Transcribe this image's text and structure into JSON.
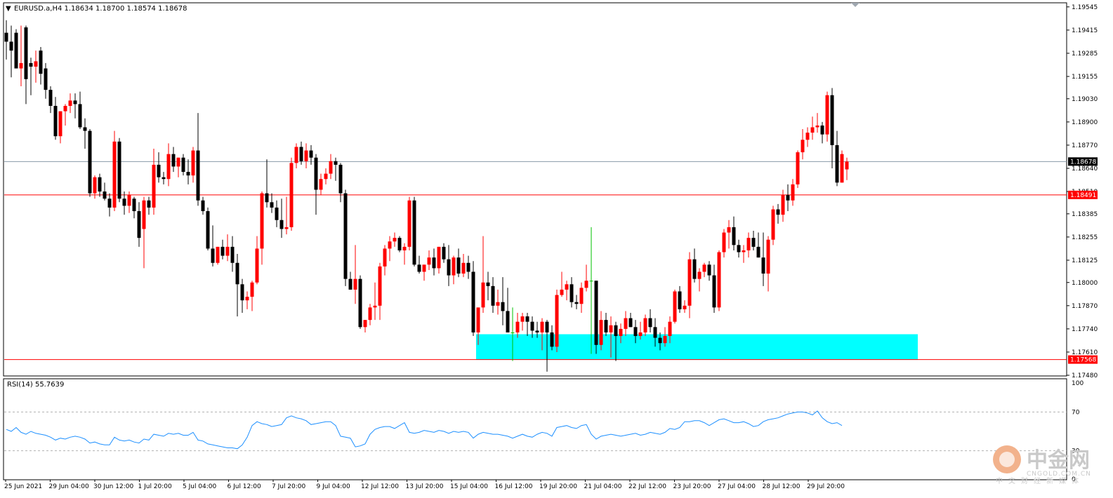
{
  "chart_header": {
    "symbol_line": "EURUSD.a,H4  1.18634 1.18700 1.18574 1.18678",
    "collapse_arrow": "triangle-down-icon"
  },
  "rsi_panel": {
    "label": "RSI(14) 55.7639",
    "levels": [
      "100",
      "70",
      "30",
      "0"
    ]
  },
  "price_axis": {
    "ticks": [
      "1.19545",
      "1.19415",
      "1.19285",
      "1.19155",
      "1.19030",
      "1.18900",
      "1.18770",
      "1.18640",
      "1.18510",
      "1.18385",
      "1.18255",
      "1.18125",
      "1.18000",
      "1.17870",
      "1.17740",
      "1.17610",
      "1.17480"
    ],
    "current_price_tag": "1.18678",
    "resistance_tag": "1.18491",
    "support_tag": "1.17568"
  },
  "time_axis": {
    "labels": [
      "25 Jun 2021",
      "29 Jun 04:00",
      "30 Jun 12:00",
      "1 Jul 20:00",
      "5 Jul 04:00",
      "6 Jul 12:00",
      "7 Jul 20:00",
      "9 Jul 04:00",
      "12 Jul 12:00",
      "13 Jul 20:00",
      "15 Jul 04:00",
      "16 Jul 12:00",
      "19 Jul 20:00",
      "21 Jul 04:00",
      "22 Jul 12:00",
      "23 Jul 20:00",
      "27 Jul 04:00",
      "28 Jul 12:00",
      "29 Jul 20:00"
    ]
  },
  "watermark": {
    "brand_cn": "中金网",
    "brand_url": "CNGOLD.COM.CN",
    "tagline": "中文财经新媒体"
  },
  "colors": {
    "bull": "#ff0000",
    "bear": "#000000",
    "doji": "#00c000",
    "support_zone": "#00ffff",
    "hline": "#ff0000",
    "current_line": "#8a9aa8",
    "rsi_line": "#1e90ff",
    "tag_bg_current": "#000000",
    "tag_bg_level": "#ff0000"
  },
  "chart_data": {
    "type": "candlestick",
    "symbol": "EURUSD.a",
    "timeframe": "H4",
    "ylim": [
      1.1748,
      1.1956
    ],
    "horizontal_levels": [
      1.18491,
      1.17568
    ],
    "current_price": 1.18678,
    "support_zone": {
      "price_low": 1.17568,
      "price_high": 1.1771,
      "from_bar": 96,
      "to_bar": 185
    },
    "candles": [
      [
        1.194,
        1.1947,
        1.1925,
        1.1935
      ],
      [
        1.1935,
        1.1944,
        1.1915,
        1.193
      ],
      [
        1.194,
        1.1942,
        1.192,
        1.192
      ],
      [
        1.192,
        1.1944,
        1.191,
        1.1923
      ],
      [
        1.1943,
        1.1944,
        1.19,
        1.1914
      ],
      [
        1.1923,
        1.1926,
        1.1905,
        1.1921
      ],
      [
        1.1921,
        1.193,
        1.1912,
        1.1924
      ],
      [
        1.193,
        1.1932,
        1.1911,
        1.1917
      ],
      [
        1.192,
        1.1923,
        1.1903,
        1.1908
      ],
      [
        1.1908,
        1.191,
        1.1895,
        1.1899
      ],
      [
        1.1899,
        1.1904,
        1.188,
        1.1882
      ],
      [
        1.1882,
        1.1896,
        1.1878,
        1.1896
      ],
      [
        1.1896,
        1.19,
        1.1888,
        1.1899
      ],
      [
        1.1899,
        1.1906,
        1.1895,
        1.1902
      ],
      [
        1.1902,
        1.1906,
        1.1892,
        1.19
      ],
      [
        1.19,
        1.1907,
        1.1886,
        1.1887
      ],
      [
        1.1887,
        1.1892,
        1.1875,
        1.1885
      ],
      [
        1.1885,
        1.1886,
        1.1848,
        1.185
      ],
      [
        1.185,
        1.186,
        1.1847,
        1.1859
      ],
      [
        1.1859,
        1.1861,
        1.1848,
        1.1851
      ],
      [
        1.1851,
        1.1856,
        1.1846,
        1.1847
      ],
      [
        1.1847,
        1.185,
        1.1837,
        1.1842
      ],
      [
        1.1842,
        1.1885,
        1.184,
        1.1879
      ],
      [
        1.1879,
        1.1881,
        1.1845,
        1.1847
      ],
      [
        1.1847,
        1.1851,
        1.1838,
        1.1843
      ],
      [
        1.1843,
        1.1851,
        1.1839,
        1.1849
      ],
      [
        1.1847,
        1.1848,
        1.1836,
        1.184
      ],
      [
        1.184,
        1.1845,
        1.182,
        1.1825
      ],
      [
        1.183,
        1.1848,
        1.1808,
        1.1846
      ],
      [
        1.1846,
        1.1848,
        1.1838,
        1.1842
      ],
      [
        1.1842,
        1.1875,
        1.1838,
        1.1866
      ],
      [
        1.1866,
        1.1873,
        1.1856,
        1.1859
      ],
      [
        1.1859,
        1.1862,
        1.1855,
        1.1858
      ],
      [
        1.1858,
        1.1878,
        1.1854,
        1.1872
      ],
      [
        1.1872,
        1.1876,
        1.1862,
        1.1865
      ],
      [
        1.1865,
        1.187,
        1.1859,
        1.187
      ],
      [
        1.187,
        1.1872,
        1.186,
        1.1862
      ],
      [
        1.1862,
        1.1869,
        1.1855,
        1.186
      ],
      [
        1.186,
        1.1876,
        1.1856,
        1.1874
      ],
      [
        1.1874,
        1.1895,
        1.1843,
        1.1846
      ],
      [
        1.1846,
        1.1848,
        1.1838,
        1.184
      ],
      [
        1.184,
        1.1842,
        1.1818,
        1.1819
      ],
      [
        1.1819,
        1.1832,
        1.1809,
        1.1811
      ],
      [
        1.1811,
        1.182,
        1.181,
        1.182
      ],
      [
        1.182,
        1.1824,
        1.1813,
        1.1815
      ],
      [
        1.1815,
        1.1827,
        1.1812,
        1.182
      ],
      [
        1.182,
        1.1826,
        1.1806,
        1.1811
      ],
      [
        1.1811,
        1.1816,
        1.1781,
        1.1799
      ],
      [
        1.1799,
        1.1802,
        1.1783,
        1.179
      ],
      [
        1.179,
        1.1795,
        1.1785,
        1.1792
      ],
      [
        1.1792,
        1.1801,
        1.1784,
        1.18
      ],
      [
        1.18,
        1.1826,
        1.1799,
        1.1819
      ],
      [
        1.1819,
        1.1851,
        1.181,
        1.185
      ],
      [
        1.185,
        1.1869,
        1.1842,
        1.1845
      ],
      [
        1.1845,
        1.185,
        1.1839,
        1.1842
      ],
      [
        1.1842,
        1.1846,
        1.1831,
        1.1835
      ],
      [
        1.1835,
        1.1847,
        1.1825,
        1.183
      ],
      [
        1.183,
        1.1848,
        1.1827,
        1.1831
      ],
      [
        1.1831,
        1.187,
        1.1829,
        1.1867
      ],
      [
        1.1867,
        1.1878,
        1.1864,
        1.1876
      ],
      [
        1.1876,
        1.1879,
        1.1866,
        1.1868
      ],
      [
        1.1868,
        1.1878,
        1.1864,
        1.1874
      ],
      [
        1.1874,
        1.1877,
        1.1866,
        1.187
      ],
      [
        1.187,
        1.1872,
        1.1838,
        1.1852
      ],
      [
        1.1852,
        1.1861,
        1.1849,
        1.1858
      ],
      [
        1.1858,
        1.1864,
        1.1855,
        1.1861
      ],
      [
        1.1861,
        1.1872,
        1.1858,
        1.1868
      ],
      [
        1.1868,
        1.187,
        1.1857,
        1.1866
      ],
      [
        1.1866,
        1.1867,
        1.1845,
        1.185
      ],
      [
        1.185,
        1.1852,
        1.1798,
        1.1802
      ],
      [
        1.1802,
        1.1806,
        1.1796,
        1.1796
      ],
      [
        1.1796,
        1.1821,
        1.1788,
        1.1802
      ],
      [
        1.1802,
        1.1804,
        1.1774,
        1.1775
      ],
      [
        1.1775,
        1.1779,
        1.1772,
        1.1779
      ],
      [
        1.1779,
        1.1788,
        1.1776,
        1.1786
      ],
      [
        1.1786,
        1.18,
        1.1779,
        1.1787
      ],
      [
        1.1787,
        1.1811,
        1.1779,
        1.1809
      ],
      [
        1.1809,
        1.1821,
        1.1804,
        1.1819
      ],
      [
        1.1819,
        1.1826,
        1.1812,
        1.1823
      ],
      [
        1.1823,
        1.1828,
        1.182,
        1.1825
      ],
      [
        1.1825,
        1.1826,
        1.1817,
        1.1818
      ],
      [
        1.1818,
        1.1822,
        1.181,
        1.182
      ],
      [
        1.182,
        1.1848,
        1.1818,
        1.1846
      ],
      [
        1.1846,
        1.1848,
        1.1809,
        1.181
      ],
      [
        1.181,
        1.1815,
        1.1805,
        1.1806
      ],
      [
        1.1806,
        1.181,
        1.1801,
        1.181
      ],
      [
        1.181,
        1.1818,
        1.1807,
        1.1814
      ],
      [
        1.1814,
        1.1819,
        1.1804,
        1.1808
      ],
      [
        1.1808,
        1.182,
        1.1805,
        1.182
      ],
      [
        1.182,
        1.1822,
        1.1811,
        1.1813
      ],
      [
        1.1813,
        1.1821,
        1.1798,
        1.1804
      ],
      [
        1.1804,
        1.1815,
        1.1799,
        1.1814
      ],
      [
        1.1814,
        1.1819,
        1.1803,
        1.1805
      ],
      [
        1.1805,
        1.1816,
        1.1803,
        1.1811
      ],
      [
        1.1811,
        1.1815,
        1.1802,
        1.1806
      ],
      [
        1.1806,
        1.1812,
        1.177,
        1.1772
      ],
      [
        1.1772,
        1.1782,
        1.1765,
        1.1786
      ],
      [
        1.1786,
        1.1826,
        1.1783,
        1.18
      ],
      [
        1.18,
        1.1806,
        1.179,
        1.1798
      ],
      [
        1.1798,
        1.1803,
        1.1783,
        1.1787
      ],
      [
        1.1787,
        1.1796,
        1.1782,
        1.1789
      ],
      [
        1.1789,
        1.1803,
        1.1776,
        1.1784
      ],
      [
        1.1784,
        1.1797,
        1.1774,
        1.1772
      ],
      [
        1.1772,
        1.1786,
        1.1756,
        1.1772
      ],
      [
        1.1772,
        1.1783,
        1.1769,
        1.1778
      ],
      [
        1.1778,
        1.1783,
        1.1773,
        1.1781
      ],
      [
        1.1781,
        1.1783,
        1.177,
        1.1778
      ],
      [
        1.1778,
        1.1781,
        1.1769,
        1.1773
      ],
      [
        1.1773,
        1.1778,
        1.1769,
        1.1772
      ],
      [
        1.1772,
        1.178,
        1.1762,
        1.1778
      ],
      [
        1.1778,
        1.1779,
        1.175,
        1.1772
      ],
      [
        1.1772,
        1.1776,
        1.1762,
        1.1764
      ],
      [
        1.1764,
        1.1796,
        1.1761,
        1.1793
      ],
      [
        1.1793,
        1.1806,
        1.1792,
        1.1796
      ],
      [
        1.1796,
        1.1801,
        1.179,
        1.1799
      ],
      [
        1.1799,
        1.1803,
        1.1786,
        1.1789
      ],
      [
        1.1789,
        1.1793,
        1.1785,
        1.1788
      ],
      [
        1.1788,
        1.18,
        1.1783,
        1.1797
      ],
      [
        1.1797,
        1.181,
        1.1795,
        1.1801
      ],
      [
        1.1801,
        1.1831,
        1.176,
        1.1801
      ],
      [
        1.1801,
        1.1801,
        1.176,
        1.1765
      ],
      [
        1.1765,
        1.1784,
        1.1762,
        1.1779
      ],
      [
        1.1779,
        1.1783,
        1.177,
        1.1772
      ],
      [
        1.1772,
        1.1781,
        1.1758,
        1.1776
      ],
      [
        1.1776,
        1.1778,
        1.1756,
        1.177
      ],
      [
        1.177,
        1.1777,
        1.1766,
        1.1774
      ],
      [
        1.1774,
        1.1784,
        1.177,
        1.178
      ],
      [
        1.178,
        1.1783,
        1.1775,
        1.1775
      ],
      [
        1.1775,
        1.1779,
        1.1766,
        1.177
      ],
      [
        1.177,
        1.1778,
        1.1768,
        1.1772
      ],
      [
        1.1772,
        1.1782,
        1.177,
        1.178
      ],
      [
        1.178,
        1.1785,
        1.1772,
        1.1775
      ],
      [
        1.1775,
        1.178,
        1.1764,
        1.1769
      ],
      [
        1.1769,
        1.1772,
        1.1762,
        1.1766
      ],
      [
        1.1766,
        1.1775,
        1.1764,
        1.177
      ],
      [
        1.177,
        1.1781,
        1.1766,
        1.1778
      ],
      [
        1.1778,
        1.1796,
        1.1777,
        1.1795
      ],
      [
        1.1795,
        1.1798,
        1.1783,
        1.1785
      ],
      [
        1.1785,
        1.179,
        1.1783,
        1.1787
      ],
      [
        1.1787,
        1.1817,
        1.178,
        1.1813
      ],
      [
        1.1813,
        1.1819,
        1.18,
        1.1802
      ],
      [
        1.1802,
        1.1808,
        1.1795,
        1.1806
      ],
      [
        1.1806,
        1.1811,
        1.1803,
        1.181
      ],
      [
        1.181,
        1.1812,
        1.1801,
        1.1804
      ],
      [
        1.1804,
        1.181,
        1.1783,
        1.1786
      ],
      [
        1.1786,
        1.1818,
        1.1784,
        1.1817
      ],
      [
        1.1817,
        1.183,
        1.1814,
        1.1828
      ],
      [
        1.1828,
        1.1835,
        1.1819,
        1.1831
      ],
      [
        1.1831,
        1.1837,
        1.1818,
        1.1821
      ],
      [
        1.1821,
        1.1824,
        1.1814,
        1.1817
      ],
      [
        1.1817,
        1.1821,
        1.1811,
        1.1818
      ],
      [
        1.1818,
        1.1828,
        1.1814,
        1.1825
      ],
      [
        1.1825,
        1.1829,
        1.1818,
        1.182
      ],
      [
        1.182,
        1.1828,
        1.1814,
        1.1814
      ],
      [
        1.1814,
        1.1828,
        1.1798,
        1.1805
      ],
      [
        1.1805,
        1.1826,
        1.1795,
        1.1824
      ],
      [
        1.1824,
        1.1843,
        1.1821,
        1.1841
      ],
      [
        1.1841,
        1.1844,
        1.1833,
        1.1838
      ],
      [
        1.1838,
        1.1852,
        1.1834,
        1.1849
      ],
      [
        1.1849,
        1.1855,
        1.184,
        1.1846
      ],
      [
        1.1846,
        1.1858,
        1.1843,
        1.1855
      ],
      [
        1.1855,
        1.1874,
        1.1853,
        1.1873
      ],
      [
        1.1873,
        1.1886,
        1.1869,
        1.188
      ],
      [
        1.188,
        1.1887,
        1.1876,
        1.1884
      ],
      [
        1.1884,
        1.1893,
        1.188,
        1.1887
      ],
      [
        1.1887,
        1.1895,
        1.1884,
        1.1888
      ],
      [
        1.1888,
        1.189,
        1.1878,
        1.1883
      ],
      [
        1.1883,
        1.1907,
        1.1879,
        1.1905
      ],
      [
        1.1905,
        1.1909,
        1.1864,
        1.1877
      ],
      [
        1.1877,
        1.1885,
        1.1854,
        1.1856
      ],
      [
        1.1856,
        1.1874,
        1.1856,
        1.1872
      ],
      [
        1.18634,
        1.187,
        1.18574,
        1.18678
      ]
    ],
    "rsi": {
      "name": "RSI(14)",
      "last": 55.7639,
      "ylim": [
        0,
        100
      ],
      "levels": [
        70,
        30
      ],
      "values": [
        52,
        50,
        54,
        49,
        47,
        50,
        48,
        47,
        46,
        44,
        41,
        43,
        42,
        44,
        45,
        44,
        42,
        38,
        39,
        37,
        36,
        36,
        44,
        41,
        40,
        41,
        39,
        38,
        42,
        41,
        47,
        46,
        45,
        48,
        47,
        48,
        46,
        46,
        49,
        41,
        40,
        37,
        36,
        35,
        34,
        33,
        33,
        32,
        36,
        44,
        56,
        60,
        58,
        57,
        55,
        56,
        57,
        64,
        66,
        64,
        63,
        61,
        57,
        58,
        59,
        60,
        60,
        56,
        45,
        44,
        43,
        34,
        35,
        37,
        47,
        52,
        54,
        55,
        55,
        53,
        56,
        59,
        49,
        48,
        49,
        51,
        50,
        49,
        51,
        50,
        48,
        50,
        49,
        50,
        49,
        43,
        47,
        49,
        48,
        47,
        47,
        46,
        45,
        43,
        45,
        47,
        45,
        44,
        47,
        49,
        48,
        45,
        54,
        55,
        56,
        54,
        53,
        56,
        57,
        47,
        42,
        45,
        46,
        47,
        46,
        45,
        46,
        47,
        48,
        46,
        47,
        49,
        48,
        47,
        49,
        53,
        52,
        54,
        60,
        60,
        61,
        61,
        59,
        56,
        59,
        62,
        63,
        61,
        59,
        59,
        60,
        58,
        55,
        56,
        60,
        62,
        63,
        64,
        66,
        68,
        69,
        70,
        70,
        69,
        67,
        71,
        64,
        60,
        58,
        59,
        56
      ]
    }
  }
}
